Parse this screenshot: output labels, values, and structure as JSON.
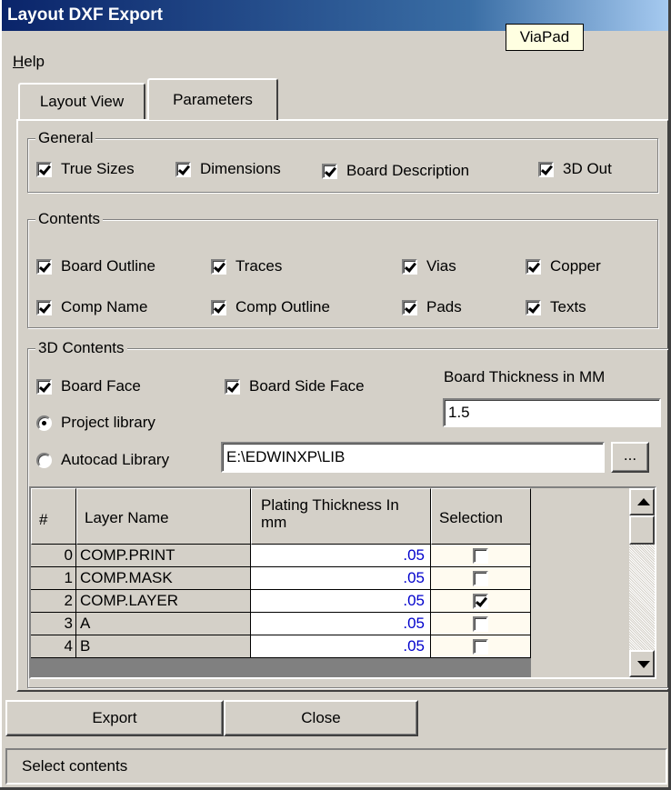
{
  "window": {
    "title": "Layout DXF Export"
  },
  "tooltip": {
    "text": "ViaPad"
  },
  "menu": {
    "help_first": "H",
    "help_rest": "elp"
  },
  "tabs": [
    {
      "label": "Layout View"
    },
    {
      "label": "Parameters"
    }
  ],
  "general": {
    "title": "General",
    "options": [
      {
        "label": "True Sizes",
        "checked": true
      },
      {
        "label": "Dimensions",
        "checked": true
      },
      {
        "label": "Board Description",
        "checked": true
      },
      {
        "label": "3D Out",
        "checked": true
      }
    ]
  },
  "contents": {
    "title": "Contents",
    "options": [
      {
        "label": "Board Outline",
        "checked": true
      },
      {
        "label": "Traces",
        "checked": true
      },
      {
        "label": "Vias",
        "checked": true
      },
      {
        "label": "Copper",
        "checked": true
      },
      {
        "label": "Comp Name",
        "checked": true
      },
      {
        "label": "Comp Outline",
        "checked": true
      },
      {
        "label": "Pads",
        "checked": true
      },
      {
        "label": "Texts",
        "checked": true
      }
    ]
  },
  "contents3d": {
    "title": "3D Contents",
    "board_face": {
      "label": "Board Face",
      "checked": true
    },
    "board_side_face": {
      "label": "Board Side Face",
      "checked": true
    },
    "thickness_label": "Board Thickness in MM",
    "thickness_value": "1.5",
    "project_library": {
      "label": "Project library",
      "selected": true
    },
    "autocad_library": {
      "label": "Autocad Library",
      "selected": false
    },
    "library_path": "E:\\EDWINXP\\LIB",
    "browse_label": "..."
  },
  "grid": {
    "headers": {
      "num": "#",
      "layer": "Layer Name",
      "plating": "Plating Thickness In mm",
      "selection": "Selection"
    },
    "rows": [
      {
        "num": "0",
        "layer": "COMP.PRINT",
        "plating": ".05",
        "selected": false
      },
      {
        "num": "1",
        "layer": "COMP.MASK",
        "plating": ".05",
        "selected": false
      },
      {
        "num": "2",
        "layer": "COMP.LAYER",
        "plating": ".05",
        "selected": true
      },
      {
        "num": "3",
        "layer": "A",
        "plating": ".05",
        "selected": false
      },
      {
        "num": "4",
        "layer": "B",
        "plating": ".05",
        "selected": false
      }
    ]
  },
  "buttons": {
    "export": "Export",
    "close": "Close"
  },
  "status": {
    "text": "Select contents"
  },
  "colors": {
    "title_start": "#0a246a",
    "face": "#d4d0c8",
    "value_blue": "#0000cc"
  }
}
